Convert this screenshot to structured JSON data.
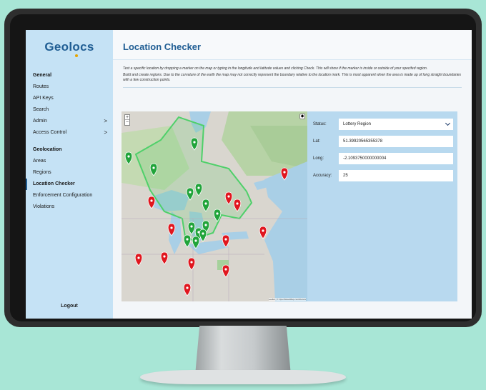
{
  "app": {
    "logo_prefix": "Geol",
    "logo_pin_letter": "o",
    "logo_suffix": "cs",
    "brand_color": "#1f5d93",
    "pin_accent": "#e7a400"
  },
  "sidebar": {
    "section_general": "General",
    "general_items": [
      {
        "label": "Routes"
      },
      {
        "label": "API Keys"
      },
      {
        "label": "Search"
      },
      {
        "label": "Admin",
        "chevron": ">"
      },
      {
        "label": "Access Control",
        "chevron": ">"
      }
    ],
    "section_geolocation": "Geolocation",
    "geo_items": [
      {
        "label": "Areas"
      },
      {
        "label": "Regions"
      },
      {
        "label": "Location Checker",
        "active": true
      },
      {
        "label": "Enforcement Configuration"
      },
      {
        "label": "Violations"
      }
    ],
    "logout": "Logout"
  },
  "page": {
    "title": "Location Checker",
    "desc1": "Test a specific location by dropping a marker on the map or typing in the longitude and latitude values and clicking Check. This will show if the marker is inside or outside of your specifed region.",
    "desc2": "Build and create regions. Due to the curvature of the earth the map may not correctly represent the boundary relative to the location mark. This is most apparent when the area is made up of long straight boundaries with a few construction points."
  },
  "map": {
    "zoom_in": "+",
    "zoom_out": "−",
    "layers": "◆",
    "attribution": "Leaflet | © OpenStreetMap contributors",
    "marker_colors": {
      "inside": "#21a43a",
      "outside": "#e0171f"
    }
  },
  "form": {
    "status_label": "Status:",
    "status_value": "Lottery Region",
    "lat_label": "Lat:",
    "lat_value": "51.39920565355378",
    "long_label": "Long:",
    "long_value": "-2.1093750000000004",
    "accuracy_label": "Accuracy:",
    "accuracy_value": "25"
  }
}
